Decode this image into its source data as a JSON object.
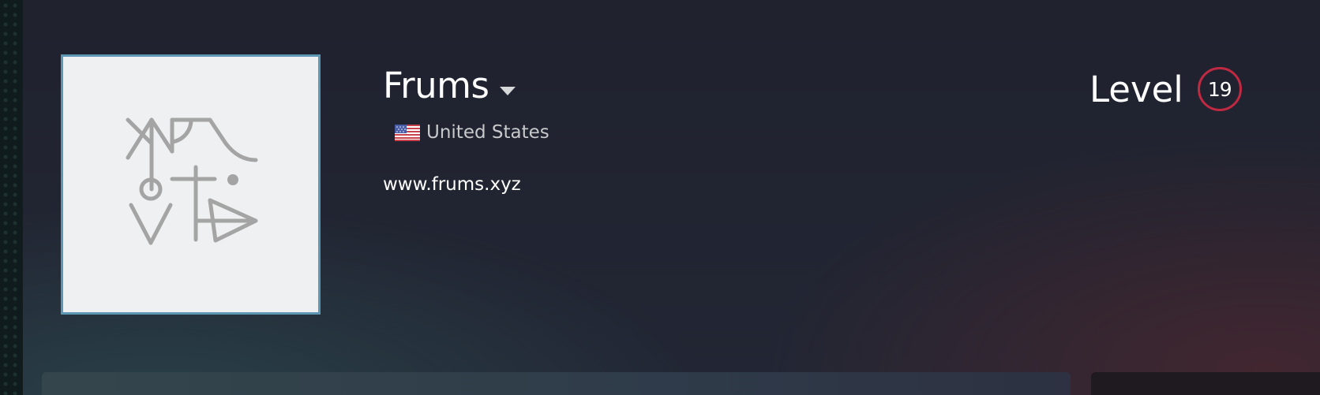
{
  "profile": {
    "persona_name": "Frums",
    "location": "United States",
    "website": "www.frums.xyz",
    "level_label": "Level",
    "level_value": "19"
  },
  "icons": {
    "persona_dropdown": "chevron-down-icon",
    "location_flag": "us-flag-icon"
  },
  "colors": {
    "avatar_border": "#5d97b4",
    "avatar_bg": "#eef0f1",
    "avatar_glyph": "#a4a4a4",
    "level_ring": "#c02942",
    "text_primary": "#ffffff",
    "text_secondary": "#c8c9cb"
  }
}
